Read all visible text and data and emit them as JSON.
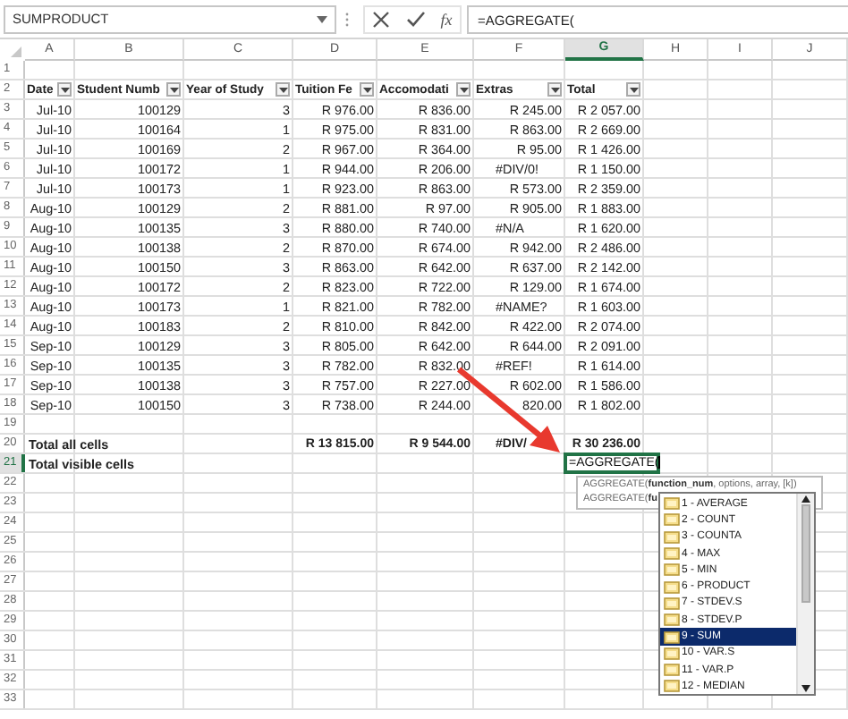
{
  "formula_bar": {
    "name_box": "SUMPRODUCT",
    "function_button": "fx",
    "formula": "=AGGREGATE("
  },
  "columns": [
    {
      "label": "A",
      "selected": false
    },
    {
      "label": "B",
      "selected": false
    },
    {
      "label": "C",
      "selected": false
    },
    {
      "label": "D",
      "selected": false
    },
    {
      "label": "E",
      "selected": false
    },
    {
      "label": "F",
      "selected": false
    },
    {
      "label": "G",
      "selected": true
    },
    {
      "label": "H",
      "selected": false
    },
    {
      "label": "I",
      "selected": false
    },
    {
      "label": "J",
      "selected": false
    }
  ],
  "rows": [
    {
      "number": "1",
      "selected": false
    },
    {
      "number": "2",
      "selected": false,
      "kind": "header",
      "cells": [
        "Date",
        "Student Numb",
        "Year of Study",
        "Tuition Fe",
        "Accomodati",
        "Extras",
        "Total"
      ]
    },
    {
      "number": "3",
      "selected": false,
      "kind": "data",
      "cells": [
        "Jul-10",
        "100129",
        "3",
        "R 976.00",
        "R 836.00",
        "R 245.00",
        "R 2 057.00"
      ]
    },
    {
      "number": "4",
      "selected": false,
      "kind": "data",
      "cells": [
        "Jul-10",
        "100164",
        "1",
        "R 975.00",
        "R 831.00",
        "R 863.00",
        "R 2 669.00"
      ]
    },
    {
      "number": "5",
      "selected": false,
      "kind": "data",
      "cells": [
        "Jul-10",
        "100169",
        "2",
        "R 967.00",
        "R 364.00",
        "R 95.00",
        "R 1 426.00"
      ]
    },
    {
      "number": "6",
      "selected": false,
      "kind": "data",
      "cells": [
        "Jul-10",
        "100172",
        "1",
        "R 944.00",
        "R 206.00",
        {
          "text": "#DIV/0!",
          "kind": "error"
        },
        "R 1 150.00"
      ]
    },
    {
      "number": "7",
      "selected": false,
      "kind": "data",
      "cells": [
        "Jul-10",
        "100173",
        "1",
        "R 923.00",
        "R 863.00",
        "R 573.00",
        "R 2 359.00"
      ]
    },
    {
      "number": "8",
      "selected": false,
      "kind": "data",
      "cells": [
        "Aug-10",
        "100129",
        "2",
        "R 881.00",
        "R 97.00",
        "R 905.00",
        "R 1 883.00"
      ]
    },
    {
      "number": "9",
      "selected": false,
      "kind": "data",
      "cells": [
        "Aug-10",
        "100135",
        "3",
        "R 880.00",
        "R 740.00",
        {
          "text": "#N/A",
          "kind": "error"
        },
        "R 1 620.00"
      ]
    },
    {
      "number": "10",
      "selected": false,
      "kind": "data",
      "cells": [
        "Aug-10",
        "100138",
        "2",
        "R 870.00",
        "R 674.00",
        "R 942.00",
        "R 2 486.00"
      ]
    },
    {
      "number": "11",
      "selected": false,
      "kind": "data",
      "cells": [
        "Aug-10",
        "100150",
        "3",
        "R 863.00",
        "R 642.00",
        "R 637.00",
        "R 2 142.00"
      ]
    },
    {
      "number": "12",
      "selected": false,
      "kind": "data",
      "cells": [
        "Aug-10",
        "100172",
        "2",
        "R 823.00",
        "R 722.00",
        "R 129.00",
        "R 1 674.00"
      ]
    },
    {
      "number": "13",
      "selected": false,
      "kind": "data",
      "cells": [
        "Aug-10",
        "100173",
        "1",
        "R 821.00",
        "R 782.00",
        {
          "text": "#NAME?",
          "kind": "error"
        },
        "R 1 603.00"
      ]
    },
    {
      "number": "14",
      "selected": false,
      "kind": "data",
      "cells": [
        "Aug-10",
        "100183",
        "2",
        "R 810.00",
        "R 842.00",
        "R 422.00",
        "R 2 074.00"
      ]
    },
    {
      "number": "15",
      "selected": false,
      "kind": "data",
      "cells": [
        "Sep-10",
        "100129",
        "3",
        "R 805.00",
        "R 642.00",
        "R 644.00",
        "R 2 091.00"
      ]
    },
    {
      "number": "16",
      "selected": false,
      "kind": "data",
      "cells": [
        "Sep-10",
        "100135",
        "3",
        "R 782.00",
        "R 832.00",
        {
          "text": "#REF!",
          "kind": "error"
        },
        "R 1 614.00"
      ]
    },
    {
      "number": "17",
      "selected": false,
      "kind": "data",
      "cells": [
        "Sep-10",
        "100138",
        "3",
        "R 757.00",
        "R 227.00",
        "R 602.00",
        "R 1 586.00"
      ]
    },
    {
      "number": "18",
      "selected": false,
      "kind": "data",
      "cells": [
        "Sep-10",
        "100150",
        "3",
        "R 738.00",
        "R 244.00",
        "820.00",
        "R 1 802.00"
      ]
    },
    {
      "number": "19",
      "selected": false
    },
    {
      "number": "20",
      "selected": false,
      "kind": "total",
      "cells": [
        "Total all cells",
        "",
        "",
        "R 13 815.00",
        "R 9 544.00",
        {
          "text": "#DIV/",
          "kind": "error"
        },
        "R 30 236.00"
      ]
    },
    {
      "number": "21",
      "selected": true,
      "kind": "total",
      "cells": [
        "Total visible cells",
        "",
        "",
        "",
        "",
        "",
        "=AGGREGATE("
      ]
    },
    {
      "number": "22",
      "selected": false
    },
    {
      "number": "23",
      "selected": false
    },
    {
      "number": "24",
      "selected": false
    },
    {
      "number": "25",
      "selected": false
    },
    {
      "number": "26",
      "selected": false
    },
    {
      "number": "27",
      "selected": false
    },
    {
      "number": "28",
      "selected": false
    },
    {
      "number": "29",
      "selected": false
    },
    {
      "number": "30",
      "selected": false
    },
    {
      "number": "31",
      "selected": false
    },
    {
      "number": "32",
      "selected": false
    },
    {
      "number": "33",
      "selected": false
    }
  ],
  "tooltip": [
    "AGGREGATE(**function_num**, options, array, [k])",
    "AGGREGATE(**fu**"
  ],
  "function_list": [
    {
      "label": "1 - AVERAGE",
      "selected": false
    },
    {
      "label": "2 - COUNT",
      "selected": false
    },
    {
      "label": "3 - COUNTA",
      "selected": false
    },
    {
      "label": "4 - MAX",
      "selected": false
    },
    {
      "label": "5 - MIN",
      "selected": false
    },
    {
      "label": "6 - PRODUCT",
      "selected": false
    },
    {
      "label": "7 - STDEV.S",
      "selected": false
    },
    {
      "label": "8 - STDEV.P",
      "selected": false
    },
    {
      "label": "9 - SUM",
      "selected": true
    },
    {
      "label": "10 - VAR.S",
      "selected": false
    },
    {
      "label": "11 - VAR.P",
      "selected": false
    },
    {
      "label": "12 - MEDIAN",
      "selected": false
    }
  ]
}
